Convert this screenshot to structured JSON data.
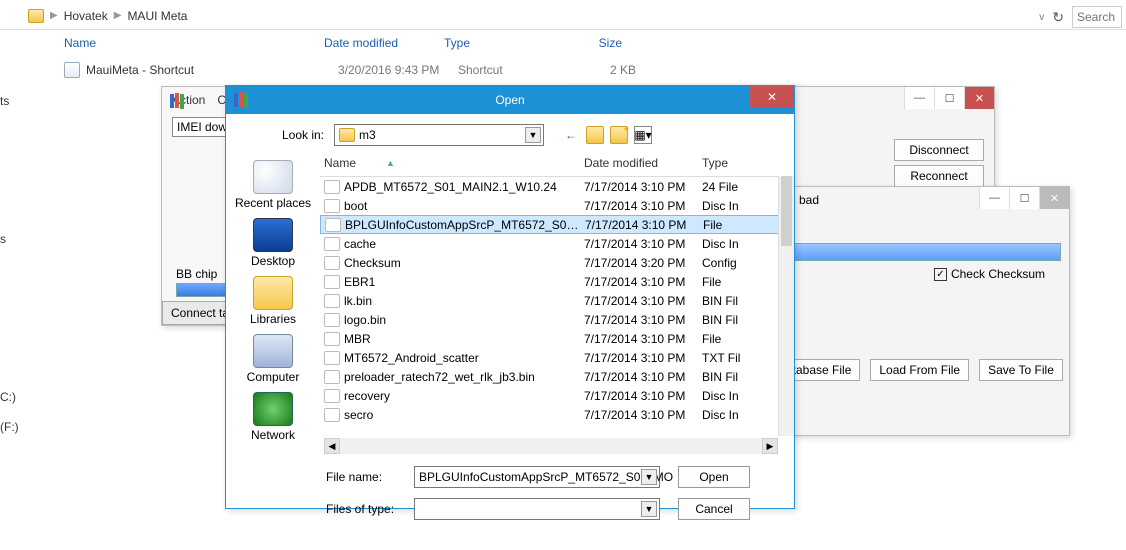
{
  "explorer": {
    "breadcrumb": [
      "Hovatek",
      "MAUI Meta"
    ],
    "search_placeholder": "Search",
    "columns": {
      "name": "Name",
      "date": "Date modified",
      "type": "Type",
      "size": "Size"
    },
    "row": {
      "name": "MauiMeta - Shortcut",
      "date": "3/20/2016 9:43 PM",
      "type": "Shortcut",
      "size": "2 KB"
    }
  },
  "sidebar_fragments": {
    "a": "ts",
    "b": "s",
    "c": "C:)",
    "d": "(F:)"
  },
  "back_window": {
    "action_tab": "Action",
    "imei_label": "IMEI dow",
    "bb_chip": "BB chip",
    "connect": "Connect ta"
  },
  "right_window": {
    "disconnect": "Disconnect",
    "reconnect": "Reconnect"
  },
  "load_window": {
    "title_fragment": "bad",
    "check_label": "Check Checksum",
    "buttons": {
      "db": "atabase File",
      "load": "Load From File",
      "save": "Save To File"
    }
  },
  "open_dialog": {
    "title": "Open",
    "look_in_label": "Look in:",
    "look_in_value": "m3",
    "places": {
      "recent": "Recent places",
      "desktop": "Desktop",
      "libraries": "Libraries",
      "computer": "Computer",
      "network": "Network"
    },
    "headers": {
      "name": "Name",
      "date": "Date modified",
      "type": "Type"
    },
    "files": [
      {
        "name": "APDB_MT6572_S01_MAIN2.1_W10.24",
        "date": "7/17/2014 3:10 PM",
        "type": "24 File",
        "selected": false
      },
      {
        "name": "boot",
        "date": "7/17/2014 3:10 PM",
        "type": "Disc In",
        "selected": false
      },
      {
        "name": "BPLGUInfoCustomAppSrcP_MT6572_S00_M...",
        "date": "7/17/2014 3:10 PM",
        "type": "File",
        "selected": true
      },
      {
        "name": "cache",
        "date": "7/17/2014 3:10 PM",
        "type": "Disc In",
        "selected": false
      },
      {
        "name": "Checksum",
        "date": "7/17/2014 3:20 PM",
        "type": "Config",
        "selected": false
      },
      {
        "name": "EBR1",
        "date": "7/17/2014 3:10 PM",
        "type": "File",
        "selected": false
      },
      {
        "name": "lk.bin",
        "date": "7/17/2014 3:10 PM",
        "type": "BIN Fil",
        "selected": false
      },
      {
        "name": "logo.bin",
        "date": "7/17/2014 3:10 PM",
        "type": "BIN Fil",
        "selected": false
      },
      {
        "name": "MBR",
        "date": "7/17/2014 3:10 PM",
        "type": "File",
        "selected": false
      },
      {
        "name": "MT6572_Android_scatter",
        "date": "7/17/2014 3:10 PM",
        "type": "TXT Fil",
        "selected": false
      },
      {
        "name": "preloader_ratech72_wet_rlk_jb3.bin",
        "date": "7/17/2014 3:10 PM",
        "type": "BIN Fil",
        "selected": false
      },
      {
        "name": "recovery",
        "date": "7/17/2014 3:10 PM",
        "type": "Disc In",
        "selected": false
      },
      {
        "name": "secro",
        "date": "7/17/2014 3:10 PM",
        "type": "Disc In",
        "selected": false
      }
    ],
    "file_name_label": "File name:",
    "file_name_value": "BPLGUInfoCustomAppSrcP_MT6572_S00_MO",
    "file_type_label": "Files of type:",
    "file_type_value": "",
    "open_btn": "Open",
    "cancel_btn": "Cancel"
  }
}
